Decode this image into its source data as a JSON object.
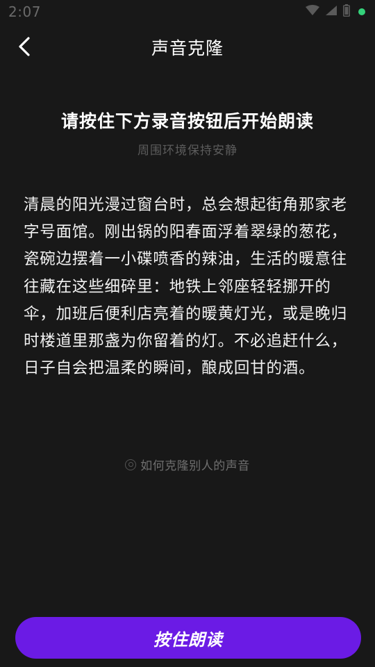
{
  "status_bar": {
    "time": "2:07",
    "icons": [
      "wifi-icon",
      "signal-icon",
      "battery-icon",
      "notification-dot-icon"
    ],
    "dot_color": "#34d27a"
  },
  "nav": {
    "title": "声音克隆",
    "back_icon": "chevron-left-icon"
  },
  "instruction": {
    "title": "请按住下方录音按钮后开始朗读",
    "hint": "周围环境保持安静"
  },
  "reading_text": "清晨的阳光漫过窗台时，总会想起街角那家老字号面馆。刚出锅的阳春面浮着翠绿的葱花，瓷碗边摆着一小碟喷香的辣油，生活的暖意往往藏在这些细碎里：地铁上邻座轻轻挪开的伞，加班后便利店亮着的暖黄灯光，或是晚归时楼道里那盏为你留着的灯。不必追赶什么，日子自会把温柔的瞬间，酿成回甘的酒。",
  "help": {
    "label": "如何克隆别人的声音",
    "icon": "target-icon"
  },
  "record_button": {
    "label": "按住朗读",
    "color": "#6b1be5"
  }
}
